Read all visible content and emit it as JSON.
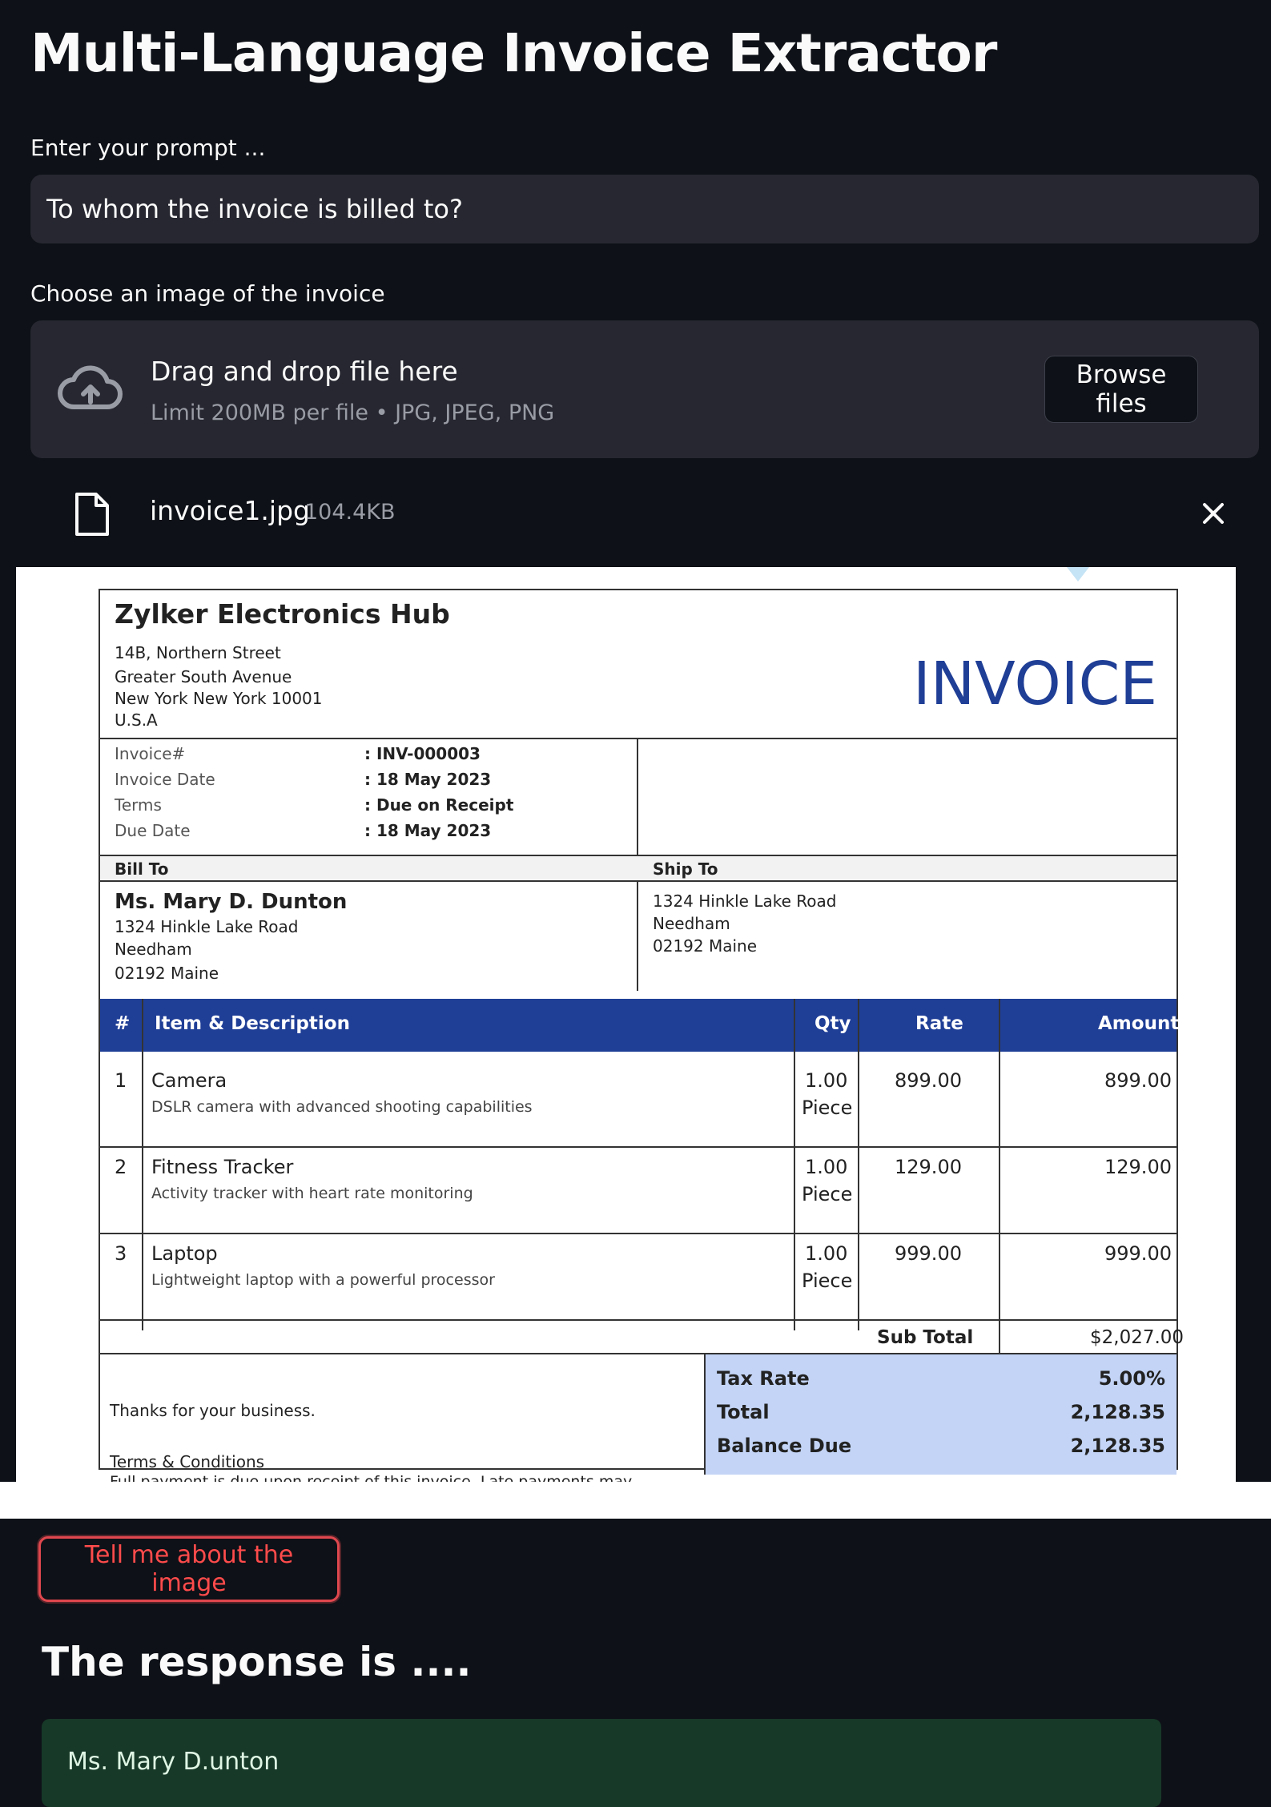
{
  "app": {
    "title": "Multi-Language Invoice Extractor"
  },
  "prompt": {
    "label": "Enter your prompt ...",
    "value": "To whom the invoice is billed to?"
  },
  "uploader": {
    "label": "Choose an image of the invoice",
    "drag_text": "Drag and drop file here",
    "limit_text": "Limit 200MB per file • JPG, JPEG, PNG",
    "browse_label": "Browse files",
    "file_name": "invoice1.jpg",
    "file_size": "104.4KB"
  },
  "invoice": {
    "company": "Zylker Electronics Hub",
    "address": [
      "14B, Northern Street",
      "Greater South Avenue",
      "New York New York 10001",
      "U.S.A"
    ],
    "heading": "INVOICE",
    "meta": [
      {
        "label": "Invoice#",
        "value": ": INV-000003"
      },
      {
        "label": "Invoice Date",
        "value": ": 18 May 2023"
      },
      {
        "label": "Terms",
        "value": ": Due on Receipt"
      },
      {
        "label": "Due Date",
        "value": ": 18 May 2023"
      }
    ],
    "bill_to_label": "Bill To",
    "ship_to_label": "Ship To",
    "bill_to": {
      "name": "Ms. Mary D. Dunton",
      "lines": [
        "1324 Hinkle Lake Road",
        "Needham",
        "02192 Maine"
      ]
    },
    "ship_to": {
      "lines": [
        "1324 Hinkle Lake Road",
        "Needham",
        "02192 Maine"
      ]
    },
    "columns": {
      "num": "#",
      "item": "Item & Description",
      "qty": "Qty",
      "rate": "Rate",
      "amount": "Amount"
    },
    "items": [
      {
        "num": "1",
        "name": "Camera",
        "desc": "DSLR camera with advanced shooting capabilities",
        "qty": "1.00",
        "unit": "Piece",
        "rate": "899.00",
        "amount": "899.00"
      },
      {
        "num": "2",
        "name": "Fitness Tracker",
        "desc": "Activity tracker with heart rate monitoring",
        "qty": "1.00",
        "unit": "Piece",
        "rate": "129.00",
        "amount": "129.00"
      },
      {
        "num": "3",
        "name": "Laptop",
        "desc": "Lightweight laptop with a powerful processor",
        "qty": "1.00",
        "unit": "Piece",
        "rate": "999.00",
        "amount": "999.00"
      }
    ],
    "subtotal_label": "Sub Total",
    "subtotal_value": "$2,027.00",
    "thanks": "Thanks for your business.",
    "terms_label": "Terms & Conditions",
    "terms_text": "Full payment is due upon receipt of this invoice. Late payments may",
    "totals": [
      {
        "label": "Tax Rate",
        "value": "5.00%"
      },
      {
        "label": "Total",
        "value": "2,128.35"
      },
      {
        "label": "Balance Due",
        "value": "2,128.35"
      }
    ],
    "heading_color": "#1f3e96",
    "header_band_color": "#1f3e96",
    "totals_band_color": "#c3d4f6"
  },
  "action": {
    "button_label": "Tell me about the image"
  },
  "response": {
    "title": "The response is ....",
    "text": "Ms. Mary D.unton"
  },
  "colors": {
    "background": "#0e1117",
    "input_bg": "#262730",
    "accent_red": "#ff4b4b",
    "success_bg": "#173928"
  }
}
